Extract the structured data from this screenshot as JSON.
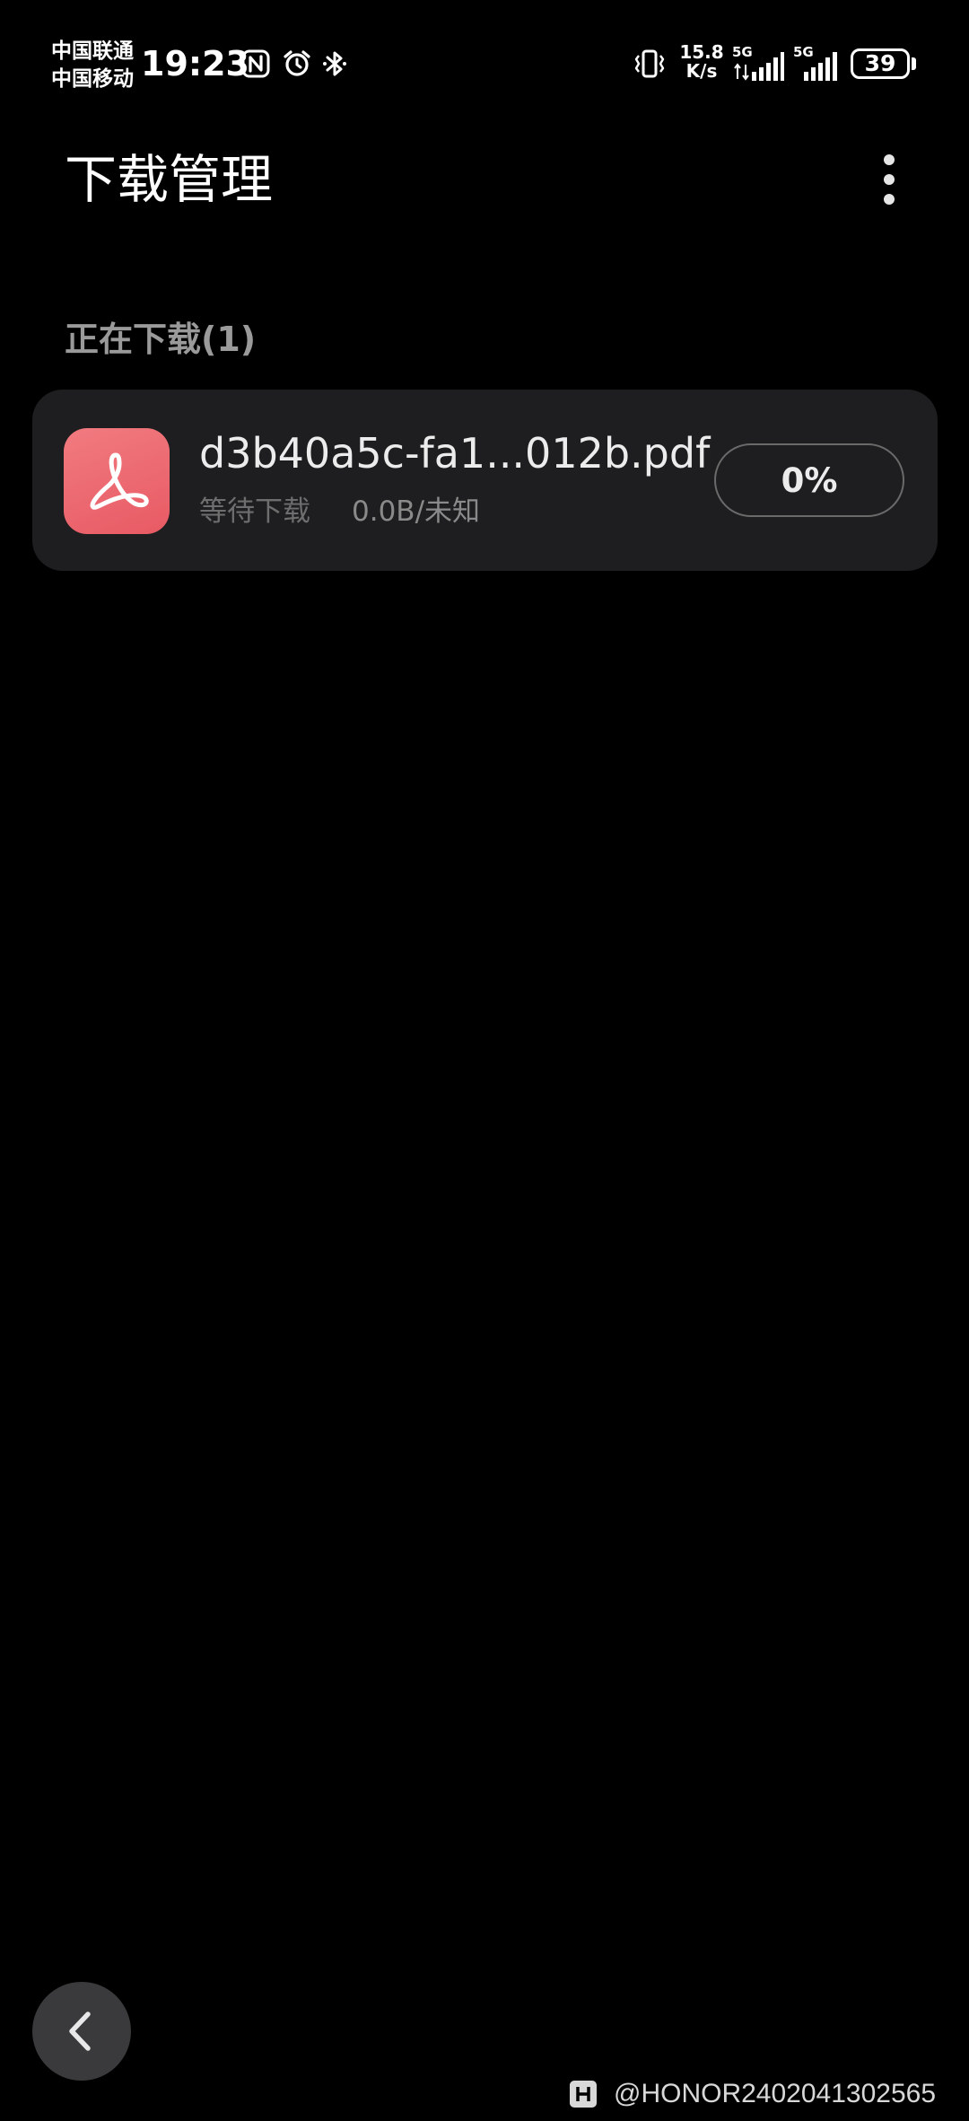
{
  "status_bar": {
    "carrier_1": "中国联通",
    "carrier_2": "中国移动",
    "time": "19:23",
    "icons": [
      "nfc-icon",
      "alarm-icon",
      "bluetooth-icon",
      "vibrate-icon"
    ],
    "net_speed_value": "15.8",
    "net_speed_unit": "K/s",
    "sim1_generation": "5G",
    "sim2_generation": "5G",
    "battery_level": "39"
  },
  "header": {
    "title": "下载管理",
    "more_icon": "more-vertical-icon"
  },
  "section": {
    "downloading_label": "正在下载(1)"
  },
  "downloads": [
    {
      "file_name": "d3b40a5c-fa1...012b.pdf",
      "file_icon": "pdf-file-icon",
      "status": "等待下载",
      "size": "0.0B/未知",
      "progress_label": "0%",
      "progress_fraction": 0
    }
  ],
  "navigation": {
    "back_icon": "chevron-left-icon"
  },
  "watermark": {
    "text": "@HONOR2402041302565",
    "logo_icon": "honor-logo-icon"
  },
  "colors": {
    "background": "#000000",
    "card": "#1e1e20",
    "pdf_icon": "#ee6a72",
    "secondary_text": "#9a9a9a",
    "back_button": "#3a3a3c"
  }
}
